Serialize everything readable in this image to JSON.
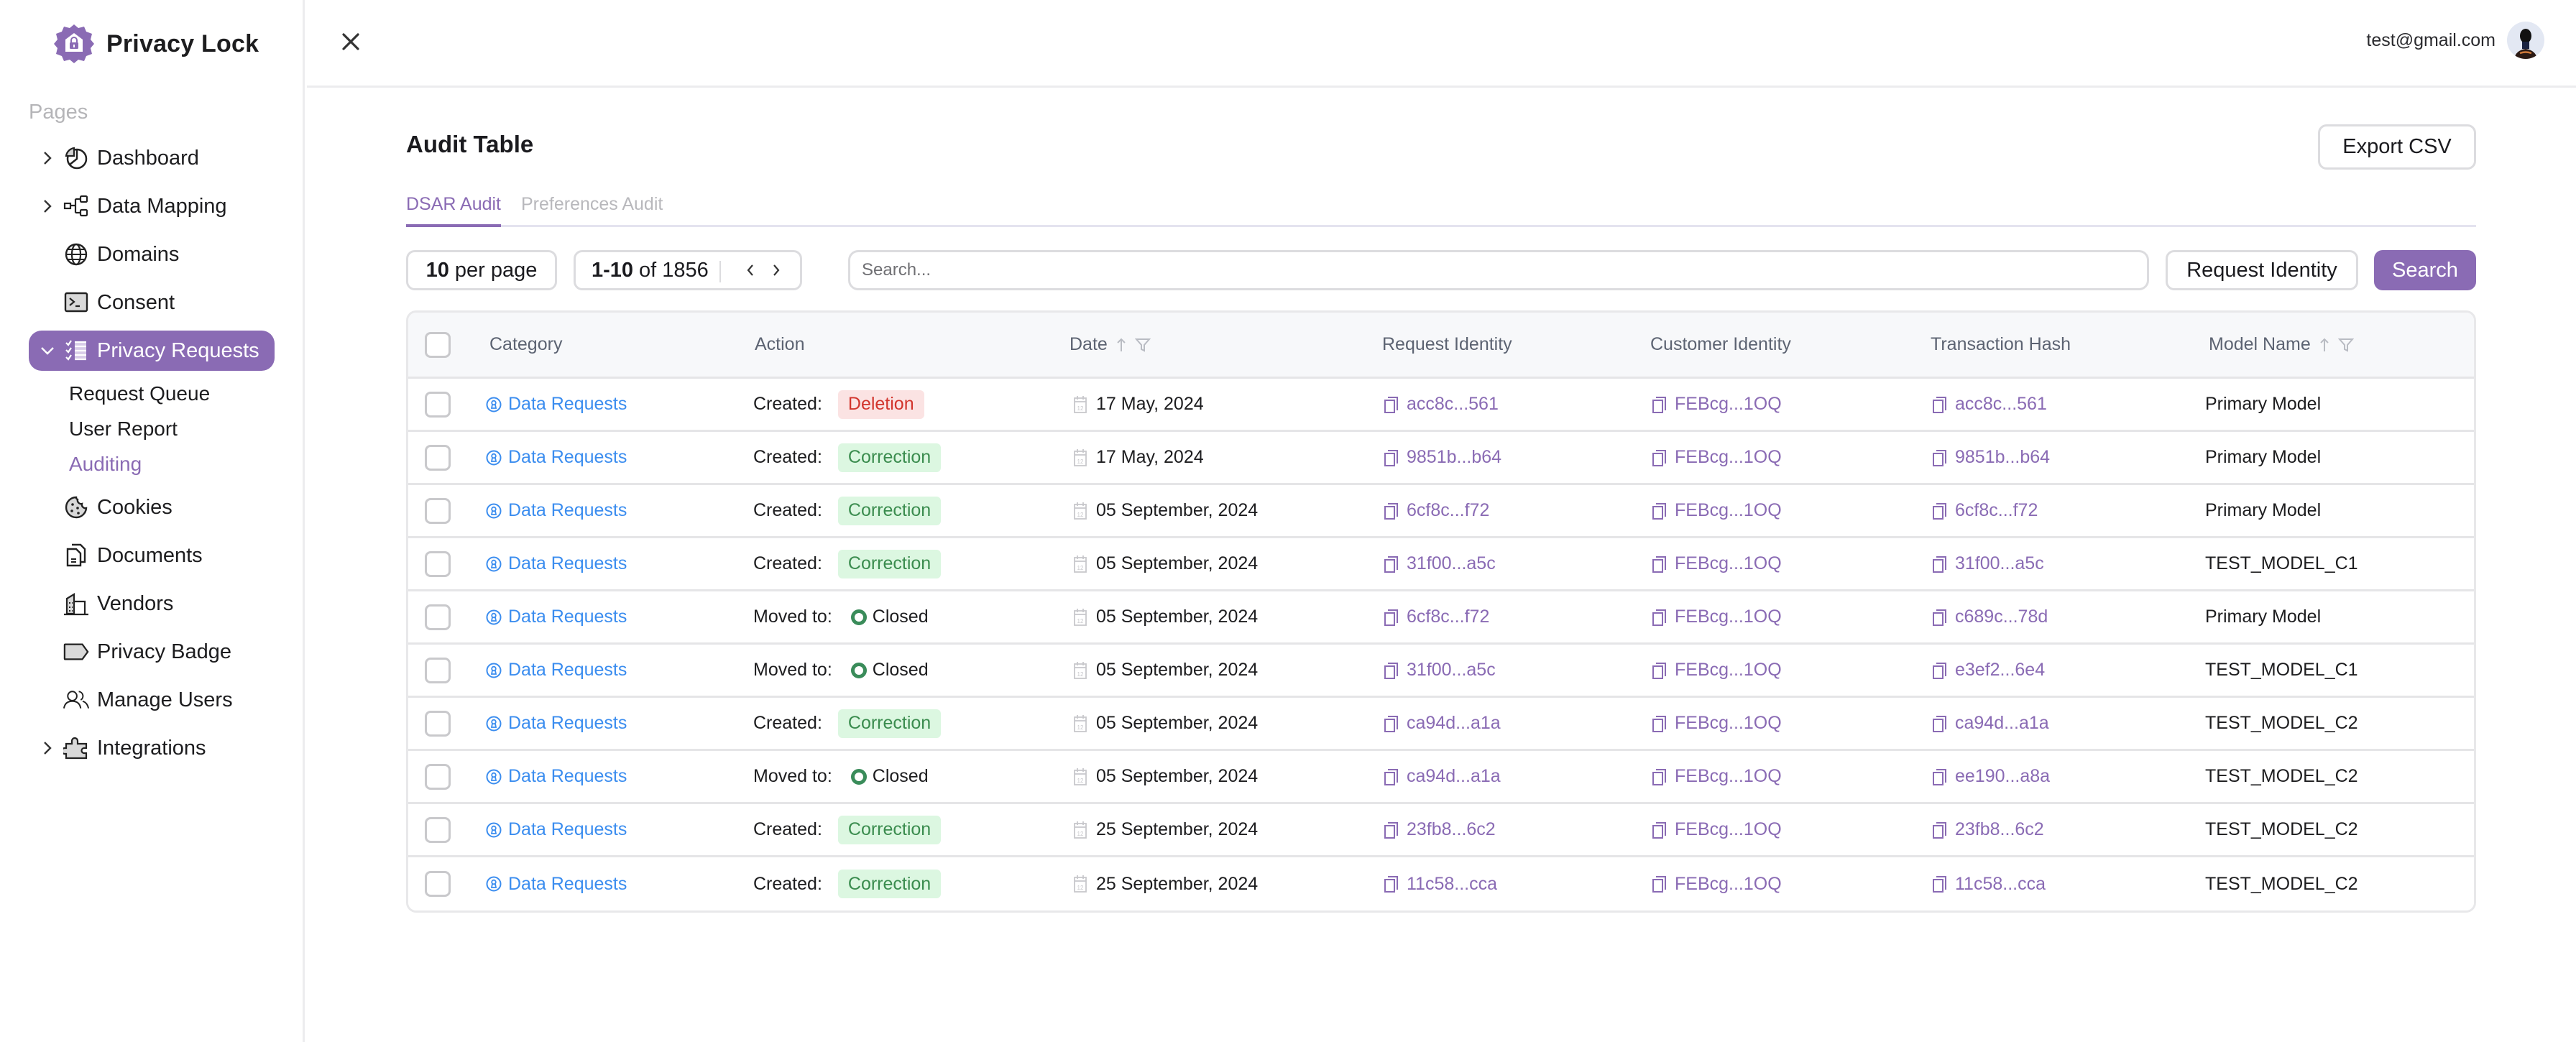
{
  "app": {
    "name": "Privacy Lock",
    "brand_color": "#8a6bb4"
  },
  "sidebar": {
    "section_label": "Pages",
    "items": [
      {
        "label": "Dashboard",
        "icon": "pie-chart-icon",
        "expandable": true,
        "expanded": false,
        "active": false
      },
      {
        "label": "Data Mapping",
        "icon": "hierarchy-icon",
        "expandable": true,
        "expanded": false,
        "active": false
      },
      {
        "label": "Domains",
        "icon": "globe-icon",
        "expandable": false,
        "active": false
      },
      {
        "label": "Consent",
        "icon": "terminal-icon",
        "expandable": false,
        "active": false
      },
      {
        "label": "Privacy Requests",
        "icon": "checklist-icon",
        "expandable": true,
        "expanded": true,
        "active": true,
        "children": [
          {
            "label": "Request Queue",
            "active": false
          },
          {
            "label": "User Report",
            "active": false
          },
          {
            "label": "Auditing",
            "active": true
          }
        ]
      },
      {
        "label": "Cookies",
        "icon": "cookie-icon",
        "expandable": false,
        "active": false
      },
      {
        "label": "Documents",
        "icon": "documents-icon",
        "expandable": false,
        "active": false
      },
      {
        "label": "Vendors",
        "icon": "building-icon",
        "expandable": false,
        "active": false
      },
      {
        "label": "Privacy Badge",
        "icon": "tag-icon",
        "expandable": false,
        "active": false
      },
      {
        "label": "Manage Users",
        "icon": "users-icon",
        "expandable": false,
        "active": false
      },
      {
        "label": "Integrations",
        "icon": "puzzle-icon",
        "expandable": true,
        "expanded": false,
        "active": false
      }
    ]
  },
  "topbar": {
    "close_icon": "close-icon",
    "user_email": "test@gmail.com"
  },
  "main": {
    "title": "Audit Table",
    "export_label": "Export CSV",
    "tabs": [
      {
        "label": "DSAR Audit",
        "active": true
      },
      {
        "label": "Preferences Audit",
        "active": false
      }
    ],
    "per_page": {
      "value": "10",
      "suffix": "per page"
    },
    "pagination": {
      "range": "1-10",
      "of_label": "of",
      "total": "1856"
    },
    "search": {
      "placeholder": "Search...",
      "value": ""
    },
    "request_identity_label": "Request Identity",
    "search_label": "Search"
  },
  "table": {
    "columns": [
      {
        "label": "Category"
      },
      {
        "label": "Action"
      },
      {
        "label": "Date",
        "sortable": true,
        "filterable": true
      },
      {
        "label": "Request Identity"
      },
      {
        "label": "Customer Identity"
      },
      {
        "label": "Transaction Hash"
      },
      {
        "label": "Model Name",
        "sortable": true,
        "filterable": true
      }
    ],
    "rows": [
      {
        "category": "Data Requests",
        "action_label": "Created:",
        "action_type": "badge",
        "action_value": "Deletion",
        "action_style": "deletion",
        "date": "17 May, 2024",
        "request_identity": "acc8c...561",
        "customer_identity": "FEBcg...1OQ",
        "transaction_hash": "acc8c...561",
        "model_name": "Primary Model"
      },
      {
        "category": "Data Requests",
        "action_label": "Created:",
        "action_type": "badge",
        "action_value": "Correction",
        "action_style": "correction",
        "date": "17 May, 2024",
        "request_identity": "9851b...b64",
        "customer_identity": "FEBcg...1OQ",
        "transaction_hash": "9851b...b64",
        "model_name": "Primary Model"
      },
      {
        "category": "Data Requests",
        "action_label": "Created:",
        "action_type": "badge",
        "action_value": "Correction",
        "action_style": "correction",
        "date": "05 September, 2024",
        "request_identity": "6cf8c...f72",
        "customer_identity": "FEBcg...1OQ",
        "transaction_hash": "6cf8c...f72",
        "model_name": "Primary Model"
      },
      {
        "category": "Data Requests",
        "action_label": "Created:",
        "action_type": "badge",
        "action_value": "Correction",
        "action_style": "correction",
        "date": "05 September, 2024",
        "request_identity": "31f00...a5c",
        "customer_identity": "FEBcg...1OQ",
        "transaction_hash": "31f00...a5c",
        "model_name": "TEST_MODEL_C1"
      },
      {
        "category": "Data Requests",
        "action_label": "Moved to:",
        "action_type": "status",
        "action_value": "Closed",
        "action_style": "closed",
        "date": "05 September, 2024",
        "request_identity": "6cf8c...f72",
        "customer_identity": "FEBcg...1OQ",
        "transaction_hash": "c689c...78d",
        "model_name": "Primary Model"
      },
      {
        "category": "Data Requests",
        "action_label": "Moved to:",
        "action_type": "status",
        "action_value": "Closed",
        "action_style": "closed",
        "date": "05 September, 2024",
        "request_identity": "31f00...a5c",
        "customer_identity": "FEBcg...1OQ",
        "transaction_hash": "e3ef2...6e4",
        "model_name": "TEST_MODEL_C1"
      },
      {
        "category": "Data Requests",
        "action_label": "Created:",
        "action_type": "badge",
        "action_value": "Correction",
        "action_style": "correction",
        "date": "05 September, 2024",
        "request_identity": "ca94d...a1a",
        "customer_identity": "FEBcg...1OQ",
        "transaction_hash": "ca94d...a1a",
        "model_name": "TEST_MODEL_C2"
      },
      {
        "category": "Data Requests",
        "action_label": "Moved to:",
        "action_type": "status",
        "action_value": "Closed",
        "action_style": "closed",
        "date": "05 September, 2024",
        "request_identity": "ca94d...a1a",
        "customer_identity": "FEBcg...1OQ",
        "transaction_hash": "ee190...a8a",
        "model_name": "TEST_MODEL_C2"
      },
      {
        "category": "Data Requests",
        "action_label": "Created:",
        "action_type": "badge",
        "action_value": "Correction",
        "action_style": "correction",
        "date": "25 September, 2024",
        "request_identity": "23fb8...6c2",
        "customer_identity": "FEBcg...1OQ",
        "transaction_hash": "23fb8...6c2",
        "model_name": "TEST_MODEL_C2"
      },
      {
        "category": "Data Requests",
        "action_label": "Created:",
        "action_type": "badge",
        "action_value": "Correction",
        "action_style": "correction",
        "date": "25 September, 2024",
        "request_identity": "11c58...cca",
        "customer_identity": "FEBcg...1OQ",
        "transaction_hash": "11c58...cca",
        "model_name": "TEST_MODEL_C2"
      }
    ]
  }
}
